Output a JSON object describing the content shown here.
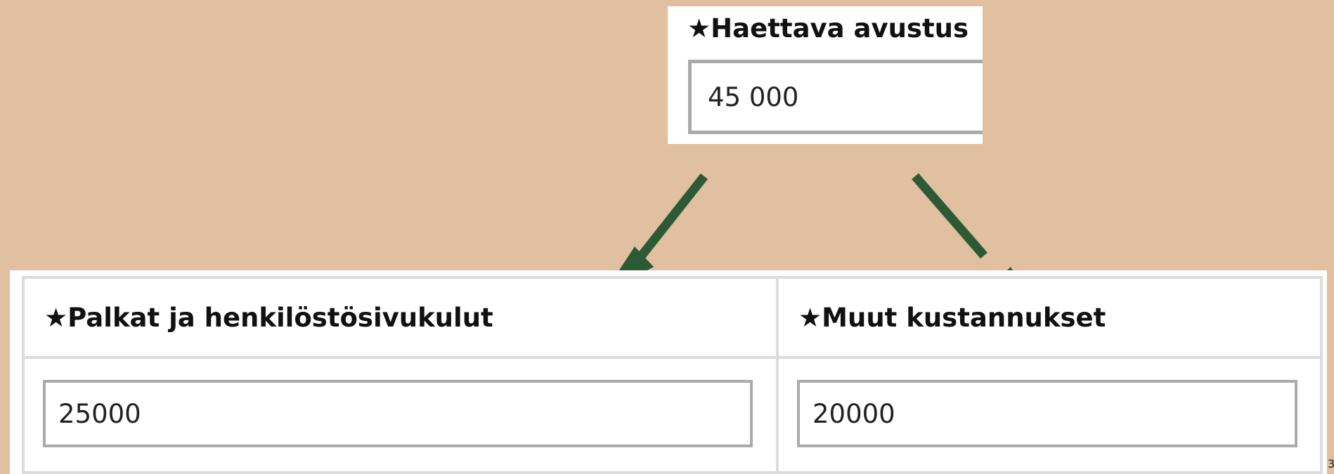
{
  "top_field": {
    "label": "★Haettava avustus",
    "value": "45 000"
  },
  "split_table": {
    "columns": [
      {
        "header": "★Palkat ja henkilöstösivukulut",
        "value": "25000"
      },
      {
        "header": "★Muut kustannukset",
        "value": "20000"
      }
    ]
  },
  "page_number": "3",
  "colors": {
    "background": "#e0c0a0",
    "arrow": "#2d5a34",
    "border": "#dcdcdc",
    "input_border": "#aaaaaa"
  }
}
